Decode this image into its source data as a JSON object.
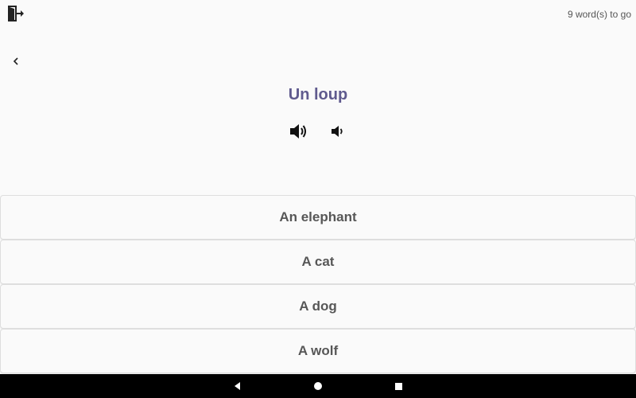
{
  "header": {
    "exit_icon": "exit-door-icon",
    "progress_text": "9 word(s) to go"
  },
  "navigation": {
    "back_icon": "chevron-left-icon"
  },
  "question": {
    "word": "Un loup",
    "audio_icons": [
      "speaker-icon",
      "speaker-slow-icon"
    ],
    "word_color": "#5f5a8e"
  },
  "answers": [
    {
      "label": "An elephant"
    },
    {
      "label": "A cat"
    },
    {
      "label": "A dog"
    },
    {
      "label": "A wolf"
    }
  ],
  "system_nav": {
    "icons": [
      "back-triangle-icon",
      "home-circle-icon",
      "recents-square-icon"
    ]
  }
}
